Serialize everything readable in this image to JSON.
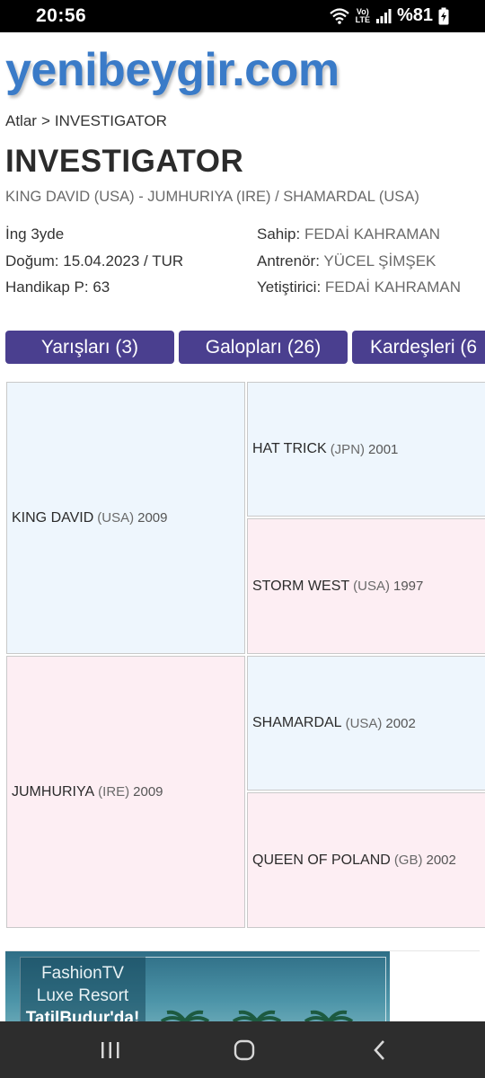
{
  "status_bar": {
    "time": "20:56",
    "battery": "%81",
    "volte_top": "Vo)",
    "volte_bottom": "LTE",
    "icons": [
      "wifi-icon",
      "volte-icon",
      "signal-icon",
      "battery-charging-icon"
    ]
  },
  "site": {
    "logo": "yenibeygir.com",
    "logo_color": "#3a7bc8"
  },
  "breadcrumb": {
    "parent": "Atlar",
    "separator": ">",
    "current": "INVESTIGATOR"
  },
  "horse": {
    "name": "INVESTIGATOR",
    "pedigree_line": "KING DAVID (USA) - JUMHURIYA (IRE) / SHAMARDAL (USA)",
    "info_left": {
      "line1": "İng 3yde",
      "line2": "Doğum: 15.04.2023 / TUR",
      "line3": "Handikap P: 63"
    },
    "info_right": {
      "owner_label": "Sahip:",
      "owner": "FEDAİ KAHRAMAN",
      "trainer_label": "Antrenör:",
      "trainer": "YÜCEL ŞİMŞEK",
      "breeder_label": "Yetiştirici:",
      "breeder": "FEDAİ KAHRAMAN"
    }
  },
  "tabs": {
    "races": "Yarışları (3)",
    "gallops": "Galopları (26)",
    "siblings": "Kardeşleri (6"
  },
  "tab_color": "#4a3f8f",
  "pedigree": {
    "sire": {
      "name": "KING DAVID",
      "country": "(USA)",
      "year": "2009"
    },
    "dam": {
      "name": "JUMHURIYA",
      "country": "(IRE)",
      "year": "2009"
    },
    "sire_sire": {
      "name": "HAT TRICK",
      "country": "(JPN)",
      "year": "2001"
    },
    "sire_dam": {
      "name": "STORM WEST",
      "country": "(USA)",
      "year": "1997"
    },
    "dam_sire": {
      "name": "SHAMARDAL",
      "country": "(USA)",
      "year": "2002"
    },
    "dam_dam": {
      "name": "QUEEN OF POLAND",
      "country": "(GB)",
      "year": "2002"
    },
    "male_color": "#eef6fd",
    "female_color": "#fdeef3"
  },
  "ad": {
    "line1": "FashionTV",
    "line2": "Luxe Resort",
    "line3": "TatilBudur'da!"
  },
  "nav": {
    "buttons": [
      "recent-apps-icon",
      "home-icon",
      "back-icon"
    ]
  }
}
